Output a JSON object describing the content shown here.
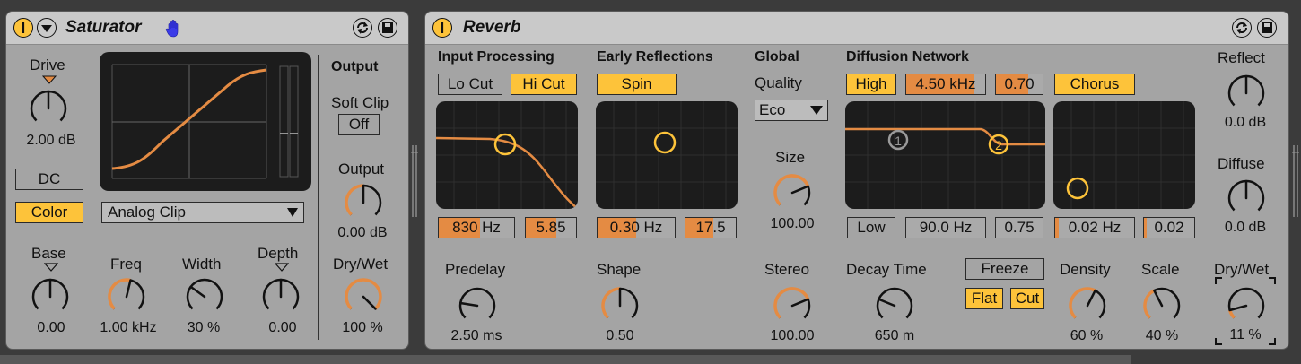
{
  "colors": {
    "accent": "#fdc33a",
    "orange": "#e48b43",
    "panel": "#a4a4a4",
    "screen": "#1c1c1c"
  },
  "saturator": {
    "title": "Saturator",
    "icons": [
      "power-icon",
      "fold-icon",
      "hand-icon",
      "hot-swap-icon",
      "save-icon"
    ],
    "drive": {
      "label": "Drive",
      "value": "2.00 dB",
      "position": 0.5
    },
    "dc_label": "DC",
    "color_label": "Color",
    "curve_type": "Analog Clip",
    "base": {
      "label": "Base",
      "value": "0.00",
      "position": 0.5
    },
    "freq": {
      "label": "Freq",
      "value": "1.00 kHz",
      "position": 0.55
    },
    "width": {
      "label": "Width",
      "value": "30 %",
      "position": 0.3
    },
    "depth": {
      "label": "Depth",
      "value": "0.00",
      "position": 0.5
    },
    "output_section": "Output",
    "soft_clip": {
      "label": "Soft Clip",
      "value": "Off"
    },
    "output": {
      "label": "Output",
      "value": "0.00 dB",
      "position": 0.5
    },
    "drywet": {
      "label": "Dry/Wet",
      "value": "100 %",
      "position": 1.0
    }
  },
  "reverb": {
    "title": "Reverb",
    "input_processing": {
      "label": "Input Processing",
      "lo_cut": "Lo Cut",
      "hi_cut": "Hi Cut",
      "freq": "830 Hz",
      "freq_fill": 0.55,
      "q": "5.85",
      "q_fill": 0.6
    },
    "early_reflections": {
      "label": "Early Reflections",
      "spin": "Spin",
      "amount": "0.30 Hz",
      "amount_fill": 0.5,
      "value2": "17.5",
      "value2_fill": 0.55
    },
    "global": {
      "label": "Global",
      "quality_label": "Quality",
      "quality": "Eco",
      "size": {
        "label": "Size",
        "value": "100.00",
        "position": 0.75
      }
    },
    "diffusion": {
      "label": "Diffusion Network",
      "high": "High",
      "high_freq": "4.50 kHz",
      "high_freq_fill": 0.85,
      "high_amt": "0.70",
      "high_amt_fill": 0.7,
      "chorus": "Chorus",
      "low": "Low",
      "low_freq": "90.0 Hz",
      "low_amt": "0.75",
      "chorus_rate": "0.02 Hz",
      "chorus_rate_fill": 0.05,
      "chorus_amt": "0.02",
      "chorus_amt_fill": 0.05
    },
    "predelay": {
      "label": "Predelay",
      "value": "2.50 ms",
      "position": 0.2
    },
    "shape": {
      "label": "Shape",
      "value": "0.50",
      "position": 0.5
    },
    "stereo": {
      "label": "Stereo",
      "value": "100.00",
      "position": 0.75
    },
    "decay": {
      "label": "Decay Time",
      "value": "650 m",
      "position": 0.25
    },
    "freeze": "Freeze",
    "flat": "Flat",
    "cut": "Cut",
    "density": {
      "label": "Density",
      "value": "60 %",
      "position": 0.6
    },
    "scale": {
      "label": "Scale",
      "value": "40 %",
      "position": 0.4
    },
    "reflect": {
      "label": "Reflect",
      "value": "0.0 dB",
      "position": 0.5
    },
    "diffuse": {
      "label": "Diffuse",
      "value": "0.0 dB",
      "position": 0.5
    },
    "drywet": {
      "label": "Dry/Wet",
      "value": "11 %",
      "position": 0.11
    },
    "markers": [
      "1",
      "2"
    ]
  }
}
